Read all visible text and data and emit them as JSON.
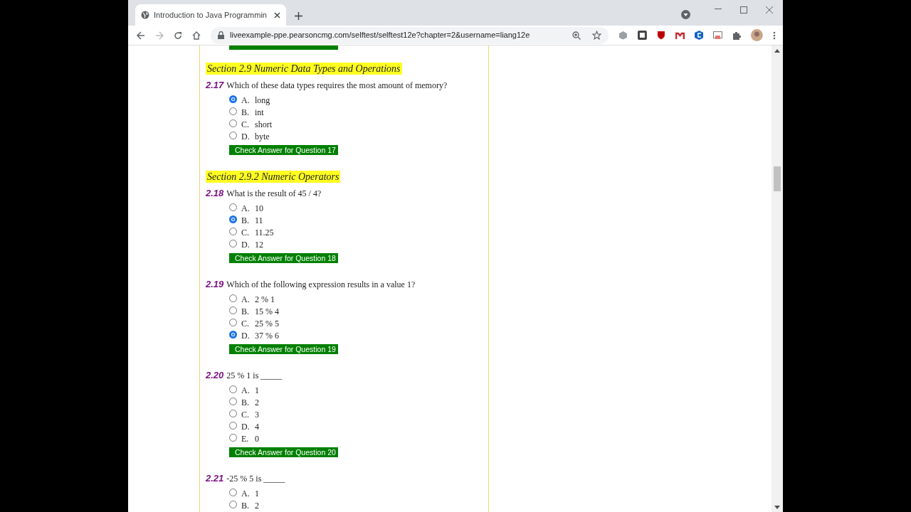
{
  "browser": {
    "tab_title": "Introduction to Java Programmin",
    "url": "liveexample-ppe.pearsoncmg.com/selftest/selftest12e?chapter=2&username=liang12e"
  },
  "page": {
    "items": [
      {
        "kind": "cut_button"
      },
      {
        "kind": "section",
        "title": "Section 2.9 Numeric Data Types and Operations"
      },
      {
        "kind": "question",
        "number": "2.17",
        "text": "Which of these data types requires the most amount of memory?",
        "options": [
          {
            "letter": "A.",
            "text": "long",
            "selected": true
          },
          {
            "letter": "B.",
            "text": "int",
            "selected": false
          },
          {
            "letter": "C.",
            "text": "short",
            "selected": false
          },
          {
            "letter": "D.",
            "text": "byte",
            "selected": false
          }
        ],
        "button": "Check Answer for Question 17"
      },
      {
        "kind": "section",
        "title": "Section 2.9.2 Numeric Operators"
      },
      {
        "kind": "question",
        "number": "2.18",
        "text": "What is the result of 45 / 4?",
        "options": [
          {
            "letter": "A.",
            "text": "10",
            "selected": false
          },
          {
            "letter": "B.",
            "text": "11",
            "selected": true
          },
          {
            "letter": "C.",
            "text": "11.25",
            "selected": false
          },
          {
            "letter": "D.",
            "text": "12",
            "selected": false
          }
        ],
        "button": "Check Answer for Question 18"
      },
      {
        "kind": "question",
        "number": "2.19",
        "text": "Which of the following expression results in a value 1?",
        "options": [
          {
            "letter": "A.",
            "text": "2 % 1",
            "selected": false
          },
          {
            "letter": "B.",
            "text": "15 % 4",
            "selected": false
          },
          {
            "letter": "C.",
            "text": "25 % 5",
            "selected": false
          },
          {
            "letter": "D.",
            "text": "37 % 6",
            "selected": true
          }
        ],
        "button": "Check Answer for Question 19"
      },
      {
        "kind": "question",
        "number": "2.20",
        "text": "25 % 1 is _____",
        "options": [
          {
            "letter": "A.",
            "text": "1",
            "selected": false
          },
          {
            "letter": "B.",
            "text": "2",
            "selected": false
          },
          {
            "letter": "C.",
            "text": "3",
            "selected": false
          },
          {
            "letter": "D.",
            "text": "4",
            "selected": false
          },
          {
            "letter": "E.",
            "text": "0",
            "selected": false
          }
        ],
        "button": "Check Answer for Question 20"
      },
      {
        "kind": "question",
        "number": "2.21",
        "text": "-25 % 5 is _____",
        "options": [
          {
            "letter": "A.",
            "text": "1",
            "selected": false
          },
          {
            "letter": "B.",
            "text": "2",
            "selected": false
          }
        ]
      }
    ]
  }
}
